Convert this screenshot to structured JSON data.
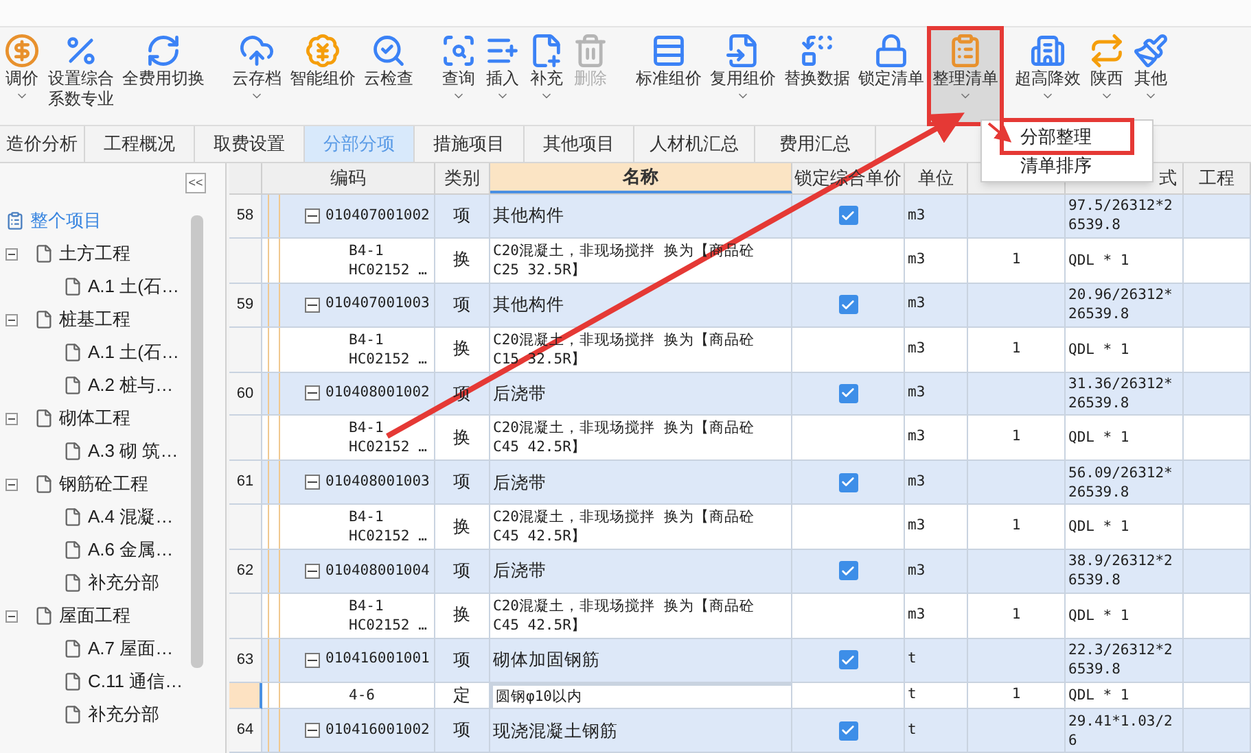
{
  "toolbar": [
    {
      "lines": [
        "调价"
      ],
      "has_menu": true,
      "disabled": false,
      "pressed": false,
      "annotated": false
    },
    {
      "lines": [
        "设置综合",
        "系数专业"
      ],
      "has_menu": false,
      "disabled": false,
      "pressed": false,
      "annotated": false
    },
    {
      "lines": [
        "全费用切换"
      ],
      "has_menu": false,
      "disabled": false,
      "pressed": false,
      "annotated": false
    },
    {
      "lines": [
        "云存档"
      ],
      "has_menu": true,
      "disabled": false,
      "pressed": false,
      "annotated": false
    },
    {
      "lines": [
        "智能组价"
      ],
      "has_menu": false,
      "disabled": false,
      "pressed": false,
      "annotated": false
    },
    {
      "lines": [
        "云检查"
      ],
      "has_menu": false,
      "disabled": false,
      "pressed": false,
      "annotated": false
    },
    {
      "lines": [
        "查询"
      ],
      "has_menu": true,
      "disabled": false,
      "pressed": false,
      "annotated": false
    },
    {
      "lines": [
        "插入"
      ],
      "has_menu": true,
      "disabled": false,
      "pressed": false,
      "annotated": false
    },
    {
      "lines": [
        "补充"
      ],
      "has_menu": true,
      "disabled": false,
      "pressed": false,
      "annotated": false
    },
    {
      "lines": [
        "删除"
      ],
      "has_menu": false,
      "disabled": true,
      "pressed": false,
      "annotated": false
    },
    {
      "lines": [
        "标准组价"
      ],
      "has_menu": false,
      "disabled": false,
      "pressed": false,
      "annotated": false
    },
    {
      "lines": [
        "复用组价"
      ],
      "has_menu": true,
      "disabled": false,
      "pressed": false,
      "annotated": false
    },
    {
      "lines": [
        "替换数据"
      ],
      "has_menu": false,
      "disabled": false,
      "pressed": false,
      "annotated": false
    },
    {
      "lines": [
        "锁定清单"
      ],
      "has_menu": false,
      "disabled": false,
      "pressed": false,
      "annotated": false
    },
    {
      "lines": [
        "整理清单"
      ],
      "has_menu": true,
      "disabled": false,
      "pressed": true,
      "annotated": true
    },
    {
      "lines": [
        "超高降效"
      ],
      "has_menu": true,
      "disabled": false,
      "pressed": false,
      "annotated": false
    },
    {
      "lines": [
        "陕西"
      ],
      "has_menu": true,
      "disabled": false,
      "pressed": false,
      "annotated": false
    },
    {
      "lines": [
        "其他"
      ],
      "has_menu": true,
      "disabled": false,
      "pressed": false,
      "annotated": false
    }
  ],
  "menu": [
    {
      "label": "分部整理",
      "annotated": true
    },
    {
      "label": "清单排序",
      "annotated": false
    }
  ],
  "tabs": [
    {
      "label": "造价分析",
      "selected": false
    },
    {
      "label": "工程概况",
      "selected": false
    },
    {
      "label": "取费设置",
      "selected": false
    },
    {
      "label": "分部分项",
      "selected": true
    },
    {
      "label": "措施项目",
      "selected": false
    },
    {
      "label": "其他项目",
      "selected": false
    },
    {
      "label": "人材机汇总",
      "selected": false
    },
    {
      "label": "费用汇总",
      "selected": false
    }
  ],
  "sidebar": {
    "collapse": "<<",
    "root": {
      "label": "整个项目",
      "selected": true
    },
    "groups": [
      {
        "label": "土方工程",
        "expanded": true,
        "selected": false,
        "children": [
          {
            "label": "A.1  土(石…",
            "selected": false
          }
        ]
      },
      {
        "label": "桩基工程",
        "expanded": true,
        "selected": false,
        "children": [
          {
            "label": "A.1  土(石…",
            "selected": false
          },
          {
            "label": "A.2  桩与…",
            "selected": false
          }
        ]
      },
      {
        "label": "砌体工程",
        "expanded": true,
        "selected": false,
        "children": [
          {
            "label": "A.3  砌 筑…",
            "selected": false
          }
        ]
      },
      {
        "label": "钢筋砼工程",
        "expanded": true,
        "selected": false,
        "children": [
          {
            "label": "A.4  混凝…",
            "selected": false
          },
          {
            "label": "A.6  金属…",
            "selected": false
          },
          {
            "label": "补充分部",
            "selected": false
          }
        ]
      },
      {
        "label": "屋面工程",
        "expanded": true,
        "selected": false,
        "children": [
          {
            "label": "A.7  屋面…",
            "selected": false
          },
          {
            "label": "C.11  通信…",
            "selected": false
          },
          {
            "label": "补充分部",
            "selected": false
          }
        ]
      }
    ]
  },
  "table": {
    "columns": [
      {
        "label": "编码",
        "sorted": false
      },
      {
        "label": "类别",
        "sorted": false
      },
      {
        "label": "名称",
        "sorted": true
      },
      {
        "label": "锁定综合单价",
        "sorted": false
      },
      {
        "label": "单位",
        "sorted": false
      },
      {
        "sorted": false
      },
      {
        "label": "式",
        "sorted": false
      },
      {
        "label": "工程",
        "sorted": false
      }
    ],
    "rows": [
      {
        "kind": "item",
        "num": "58",
        "code": [
          "010407001002"
        ],
        "type": "项",
        "name": "其他构件",
        "locked": true,
        "unit": "m3",
        "expr": "97.5/26312*26539.8",
        "selected": false
      },
      {
        "kind": "sub",
        "code": [
          "B4-1",
          "HC02152 …"
        ],
        "type": "换",
        "name": "C20混凝土，非现场搅拌  换为【商品砼 C25 32.5R】",
        "unit": "m3",
        "qty": "1",
        "expr": "QDL * 1",
        "selected": false
      },
      {
        "kind": "item",
        "num": "59",
        "code": [
          "010407001003"
        ],
        "type": "项",
        "name": "其他构件",
        "locked": true,
        "unit": "m3",
        "expr": "20.96/26312*26539.8",
        "selected": false
      },
      {
        "kind": "sub",
        "code": [
          "B4-1",
          "HC02152 …"
        ],
        "type": "换",
        "name": "C20混凝土，非现场搅拌  换为【商品砼 C15 32.5R】",
        "unit": "m3",
        "qty": "1",
        "expr": "QDL * 1",
        "selected": false
      },
      {
        "kind": "item",
        "num": "60",
        "code": [
          "010408001002"
        ],
        "type": "项",
        "name": "后浇带",
        "locked": true,
        "unit": "m3",
        "expr": "31.36/26312*26539.8",
        "selected": false
      },
      {
        "kind": "sub",
        "code": [
          "B4-1",
          "HC02152 …"
        ],
        "type": "换",
        "name": "C20混凝土，非现场搅拌  换为【商品砼 C45 42.5R】",
        "unit": "m3",
        "qty": "1",
        "expr": "QDL * 1",
        "selected": false
      },
      {
        "kind": "item",
        "num": "61",
        "code": [
          "010408001003"
        ],
        "type": "项",
        "name": "后浇带",
        "locked": true,
        "unit": "m3",
        "expr": "56.09/26312*26539.8",
        "selected": false
      },
      {
        "kind": "sub",
        "code": [
          "B4-1",
          "HC02152 …"
        ],
        "type": "换",
        "name": "C20混凝土，非现场搅拌  换为【商品砼 C45 42.5R】",
        "unit": "m3",
        "qty": "1",
        "expr": "QDL * 1",
        "selected": false
      },
      {
        "kind": "item",
        "num": "62",
        "code": [
          "010408001004"
        ],
        "type": "项",
        "name": "后浇带",
        "locked": true,
        "unit": "m3",
        "expr": "38.9/26312*26539.8",
        "selected": false
      },
      {
        "kind": "sub",
        "code": [
          "B4-1",
          "HC02152 …"
        ],
        "type": "换",
        "name": "C20混凝土，非现场搅拌  换为【商品砼 C45 42.5R】",
        "unit": "m3",
        "qty": "1",
        "expr": "QDL * 1",
        "selected": false
      },
      {
        "kind": "item",
        "num": "63",
        "code": [
          "010416001001"
        ],
        "type": "项",
        "name": "砌体加固钢筋",
        "locked": true,
        "unit": "t",
        "expr": "22.3/26312*26539.8",
        "selected": false
      },
      {
        "kind": "sub",
        "code": [
          "4-6"
        ],
        "type": "定",
        "name": "圆钢φ10以内",
        "unit": "t",
        "qty": "1",
        "expr": "QDL * 1",
        "selected": true
      },
      {
        "kind": "item",
        "num": "64",
        "code": [
          "010416001002"
        ],
        "type": "项",
        "name": "现浇混凝土钢筋",
        "locked": true,
        "unit": "t",
        "expr": "29.41*1.03/26",
        "selected": false
      }
    ]
  }
}
